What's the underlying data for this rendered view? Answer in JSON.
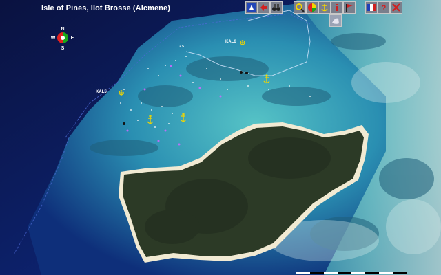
{
  "title": "Isle of Pines, Ilot Brosse (Alcmene)",
  "compass": {
    "n": "N",
    "s": "S",
    "e": "E",
    "w": "W"
  },
  "sites": [
    {
      "label": "KAL6"
    },
    {
      "label": "KAL5"
    },
    {
      "label": "2.5"
    }
  ],
  "toolbar": {
    "left": [
      "chart-icon",
      "back-arrow-icon",
      "binoculars-icon"
    ],
    "right": [
      "magnifier-icon",
      "color-wheel-icon",
      "anchor-icon",
      "info-icon",
      "flag-icon",
      "france-flag-icon",
      "help-icon",
      "close-icon"
    ],
    "extra": [
      "fish-icon"
    ]
  },
  "colors": {
    "ocean": "#0a1a5c",
    "lagoon": "#2f9bb0",
    "reef": "#9fd3d0",
    "island": "#2c3a26",
    "beach": "#f1ead3",
    "anchor": "#f2d600"
  }
}
